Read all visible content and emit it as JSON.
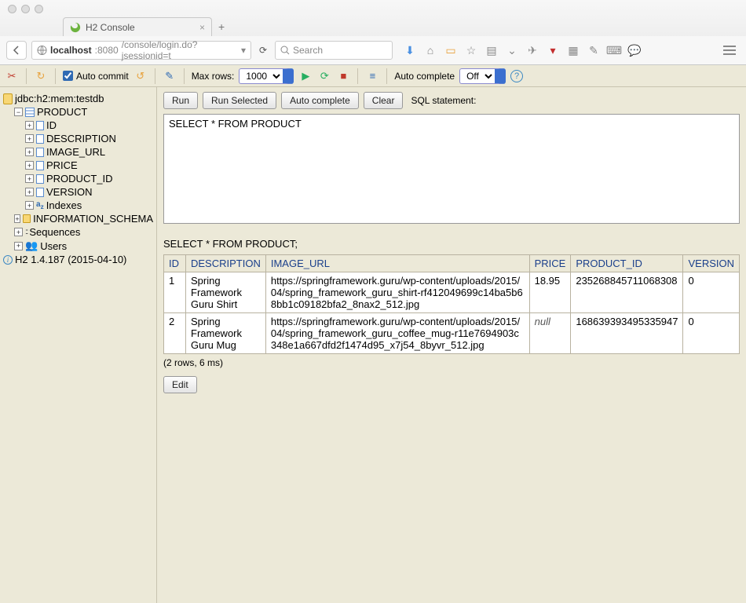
{
  "browser": {
    "tab_title": "H2 Console",
    "host": "localhost",
    "port": ":8080",
    "path": "/console/login.do?jsessionid=t",
    "search_placeholder": "Search"
  },
  "h2_toolbar": {
    "auto_commit": "Auto commit",
    "max_rows_label": "Max rows:",
    "max_rows_value": "1000",
    "auto_complete_label": "Auto complete",
    "auto_complete_value": "Off"
  },
  "sidebar": {
    "conn": "jdbc:h2:mem:testdb",
    "table": "PRODUCT",
    "columns": [
      "ID",
      "DESCRIPTION",
      "IMAGE_URL",
      "PRICE",
      "PRODUCT_ID",
      "VERSION"
    ],
    "indexes": "Indexes",
    "info_schema": "INFORMATION_SCHEMA",
    "sequences": "Sequences",
    "users": "Users",
    "version": "H2 1.4.187 (2015-04-10)"
  },
  "sql_buttons": {
    "run": "Run",
    "run_selected": "Run Selected",
    "auto_complete": "Auto complete",
    "clear": "Clear",
    "label": "SQL statement:"
  },
  "sql_text": "SELECT * FROM PRODUCT",
  "result": {
    "stmt": "SELECT * FROM PRODUCT;",
    "headers": [
      "ID",
      "DESCRIPTION",
      "IMAGE_URL",
      "PRICE",
      "PRODUCT_ID",
      "VERSION"
    ],
    "rows": [
      {
        "id": "1",
        "description": "Spring Framework Guru Shirt",
        "image_url": "https://springframework.guru/wp-content/uploads/2015/04/spring_framework_guru_shirt-rf412049699c14ba5b68bb1c09182bfa2_8nax2_512.jpg",
        "price": "18.95",
        "product_id": "235268845711068308",
        "version": "0"
      },
      {
        "id": "2",
        "description": "Spring Framework Guru Mug",
        "image_url": "https://springframework.guru/wp-content/uploads/2015/04/spring_framework_guru_coffee_mug-r11e7694903c348e1a667dfd2f1474d95_x7j54_8byvr_512.jpg",
        "price": null,
        "product_id": "168639393495335947",
        "version": "0"
      }
    ],
    "summary": "(2 rows, 6 ms)"
  },
  "edit_label": "Edit"
}
